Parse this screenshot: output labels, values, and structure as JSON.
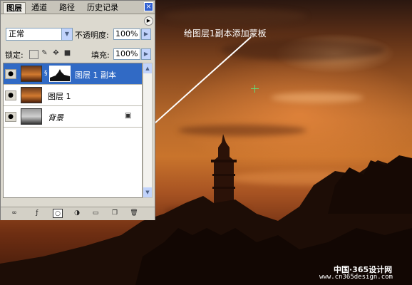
{
  "palette": {
    "tabs": [
      {
        "label": "图层",
        "active": true
      },
      {
        "label": "通道",
        "active": false
      },
      {
        "label": "路径",
        "active": false
      },
      {
        "label": "历史记录",
        "active": false
      }
    ],
    "close_label": "×",
    "blend_mode": "正常",
    "opacity_label": "不透明度:",
    "opacity_value": "100%",
    "lock_label": "锁定:",
    "fill_label": "填充:",
    "fill_value": "100%",
    "layers": [
      {
        "name": "图层 1 副本",
        "selected": true,
        "has_mask": true
      },
      {
        "name": "图层 1",
        "selected": false,
        "has_mask": false
      },
      {
        "name": "背景",
        "selected": false,
        "has_mask": false,
        "locked": true
      }
    ],
    "bottom_icons": [
      "link-icon",
      "layer-style-icon",
      "add-mask-icon",
      "adjustment-layer-icon",
      "new-group-icon",
      "new-layer-icon",
      "trash-icon"
    ]
  },
  "annotation": {
    "text": "给图层1副本添加蒙板"
  },
  "watermark": {
    "line1": "中国·365设计网",
    "line2": "www.cn365design.com"
  },
  "colors": {
    "selection": "#316ac5",
    "accent_blue": "#2f5fd1"
  }
}
